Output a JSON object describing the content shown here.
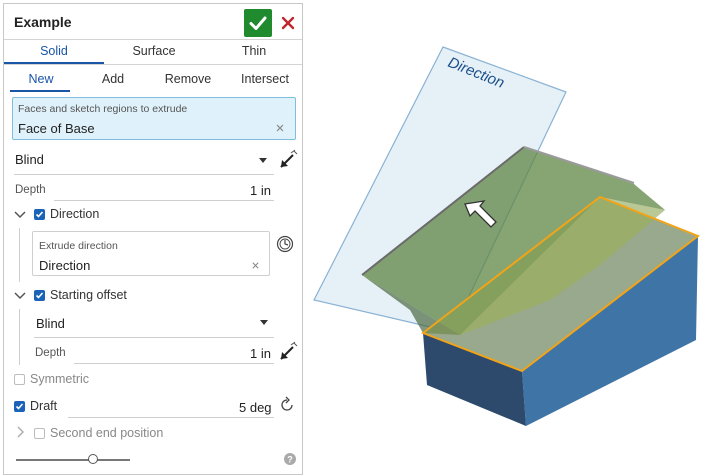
{
  "panel": {
    "title": "Example",
    "ok_icon": "checkmark-icon",
    "cancel_icon": "close-icon",
    "type_tabs": [
      "Solid",
      "Surface",
      "Thin"
    ],
    "op_tabs": [
      "New",
      "Add",
      "Remove",
      "Intersect"
    ],
    "faces": {
      "label": "Faces and sketch regions to extrude",
      "value": "Face of Base"
    },
    "end_type": "Blind",
    "depth": {
      "label": "Depth",
      "value": "1 in"
    },
    "direction": {
      "label": "Direction",
      "checked": true,
      "field_label": "Extrude direction",
      "field_value": "Direction"
    },
    "starting_offset": {
      "label": "Starting offset",
      "checked": true,
      "type": "Blind",
      "depth_label": "Depth",
      "depth_value": "1 in"
    },
    "symmetric": {
      "label": "Symmetric",
      "checked": false
    },
    "draft": {
      "label": "Draft",
      "checked": true,
      "value": "5 deg"
    },
    "second_end": {
      "label": "Second end position",
      "checked": false
    },
    "slider_level": 0.7,
    "help_icon": "help-icon"
  },
  "viewport": {
    "plane_label": "Direction",
    "colors": {
      "plane": "#dbe8f3",
      "body_top": "#8899ab",
      "body_side": "#3f74a6",
      "body_front": "#2e4c6e",
      "extrude": "#6f9a4e",
      "highlight": "#f2a418"
    }
  }
}
